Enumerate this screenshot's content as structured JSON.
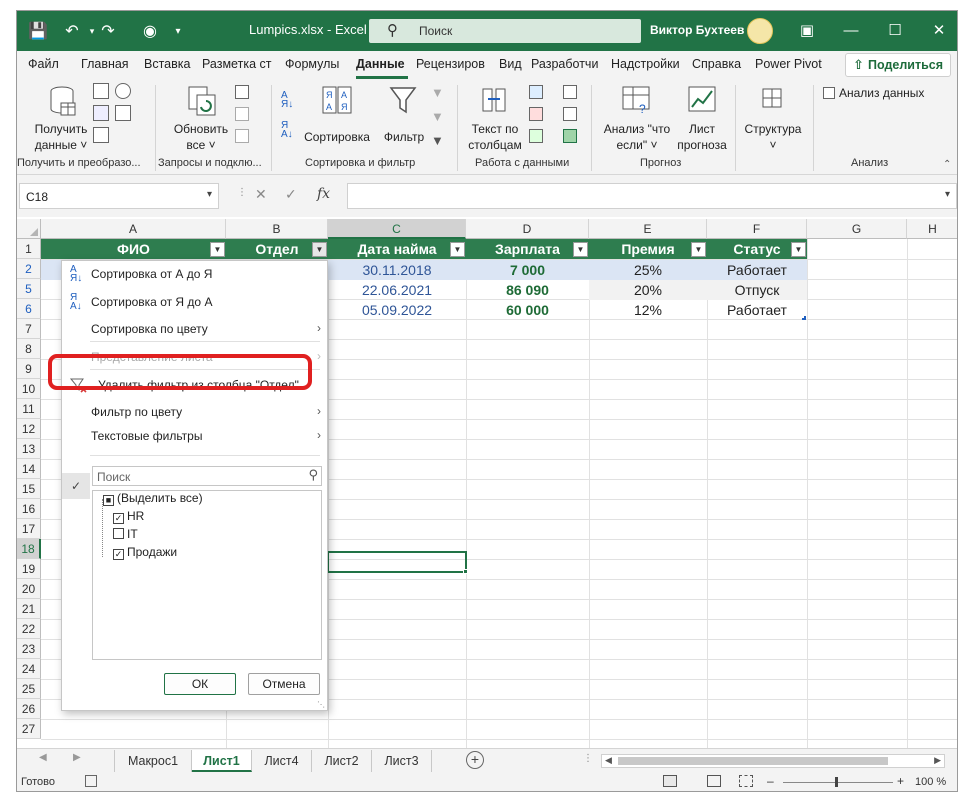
{
  "titlebar": {
    "file_title": "Lumpics.xlsx - Excel",
    "search_label": "Поиск",
    "user_name": "Виктор Бухтеев"
  },
  "ribbon_tabs": [
    "Файл",
    "Главная",
    "Вставка",
    "Разметка ст",
    "Формулы",
    "Данные",
    "Рецензиров",
    "Вид",
    "Разработчи",
    "Надстройки",
    "Справка",
    "Power Pivot"
  ],
  "active_tab": "Данные",
  "share_label": "Поделиться",
  "ribbon": {
    "get_data_label": [
      "Получить",
      "данные ˅"
    ],
    "refresh_all_label": [
      "Обновить",
      "все ˅"
    ],
    "sort_label": "Сортировка",
    "filter_label": "Фильтр",
    "text_to_columns_label": [
      "Текст по",
      "столбцам"
    ],
    "whatif_label": [
      "Анализ \"что",
      "если\" ˅"
    ],
    "forecast_sheet_label": [
      "Лист",
      "прогноза"
    ],
    "outline_label": [
      "Структура",
      "˅"
    ],
    "data_analysis_label": "Анализ данных",
    "groups": [
      "Получить и преобразо...",
      "Запросы и подклю...",
      "Сортировка и фильтр",
      "Работа с данными",
      "Прогноз",
      "Анализ"
    ]
  },
  "namebox": "C18",
  "columns": [
    "A",
    "B",
    "C",
    "D",
    "E",
    "F",
    "G",
    "H"
  ],
  "row_numbers": [
    "1",
    "2",
    "5",
    "6",
    "7",
    "8",
    "9",
    "10",
    "11",
    "12",
    "13",
    "14",
    "15",
    "16",
    "17",
    "18",
    "19",
    "20",
    "21",
    "22",
    "23",
    "24",
    "25",
    "26",
    "27"
  ],
  "table": {
    "headers": [
      "ФИО",
      "Отдел",
      "Дата найма",
      "Зарплата",
      "Премия",
      "Статус"
    ],
    "rows": [
      [
        "",
        "",
        "30.11.2018",
        "7 000",
        "25%",
        "Работает"
      ],
      [
        "",
        "",
        "22.06.2021",
        "86 090",
        "20%",
        "Отпуск"
      ],
      [
        "",
        "",
        "05.09.2022",
        "60 000",
        "12%",
        "Работает"
      ]
    ]
  },
  "filter_menu": {
    "sort_az": "Сортировка от А до Я",
    "sort_za": "Сортировка от Я до А",
    "sort_by_color": "Сортировка по цвету",
    "sheet_view": "Представление листа",
    "clear_filter": "Удалить фильтр из столбца \"Отдел\"",
    "filter_by_color": "Фильтр по цвету",
    "text_filters": "Текстовые фильтры",
    "search_placeholder": "Поиск",
    "checklist": [
      {
        "label": "(Выделить все)",
        "state": "mixed"
      },
      {
        "label": "HR",
        "state": "checked"
      },
      {
        "label": "IT",
        "state": "unchecked"
      },
      {
        "label": "Продажи",
        "state": "checked"
      }
    ],
    "ok_label": "ОК",
    "cancel_label": "Отмена"
  },
  "sheets": [
    "Макрос1",
    "Лист1",
    "Лист4",
    "Лист2",
    "Лист3"
  ],
  "active_sheet": "Лист1",
  "status": {
    "ready": "Готово",
    "zoom": "100 %"
  },
  "colors": {
    "excel_green": "#217346",
    "table_header": "#2e7d4f",
    "highlight_red": "#e02020"
  }
}
